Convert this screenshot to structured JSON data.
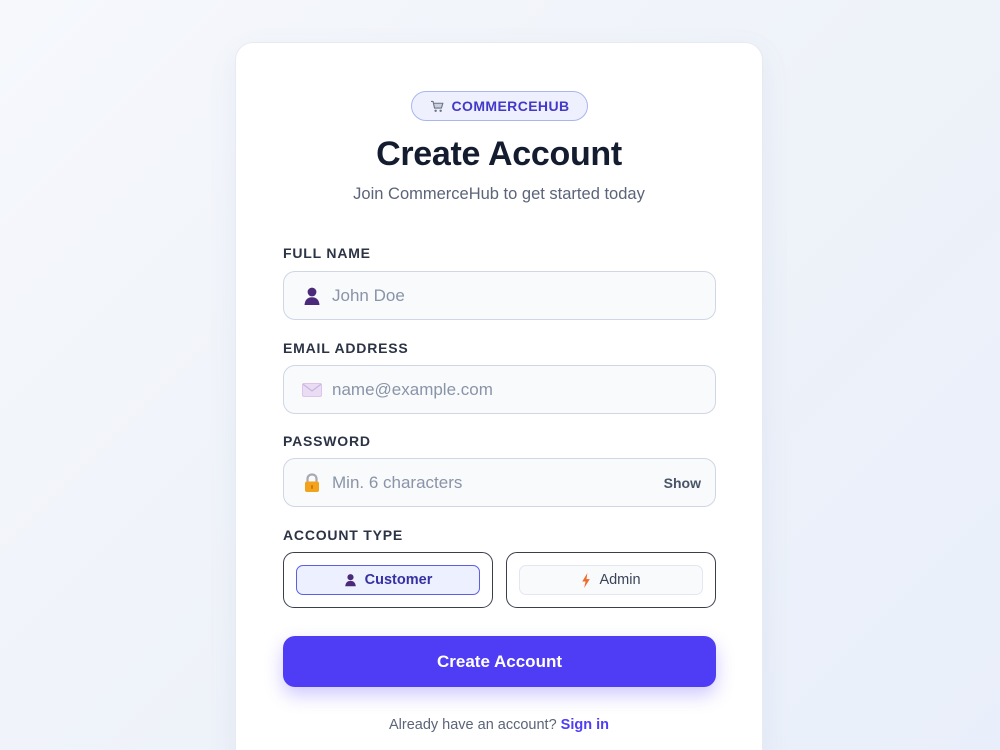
{
  "brand": {
    "name": "COMMERCEHUB",
    "icon": "cart-icon"
  },
  "header": {
    "title": "Create Account",
    "subtitle": "Join CommerceHub to get started today"
  },
  "fields": {
    "full_name": {
      "label": "FULL NAME",
      "placeholder": "John Doe",
      "value": "",
      "icon": "user-icon"
    },
    "email": {
      "label": "EMAIL ADDRESS",
      "placeholder": "name@example.com",
      "value": "",
      "icon": "envelope-icon"
    },
    "password": {
      "label": "PASSWORD",
      "placeholder": "Min. 6 characters",
      "value": "",
      "icon": "lock-icon",
      "toggle_label": "Show"
    }
  },
  "account_type": {
    "label": "ACCOUNT TYPE",
    "options": [
      {
        "label": "Customer",
        "icon": "user-icon",
        "selected": true
      },
      {
        "label": "Admin",
        "icon": "lightning-icon",
        "selected": false
      }
    ]
  },
  "submit_label": "Create Account",
  "footer": {
    "prompt": "Already have an account?",
    "link": "Sign in"
  },
  "colors": {
    "accent": "#4f3cf5",
    "badge_text": "#4338ca",
    "title": "#141c30"
  }
}
